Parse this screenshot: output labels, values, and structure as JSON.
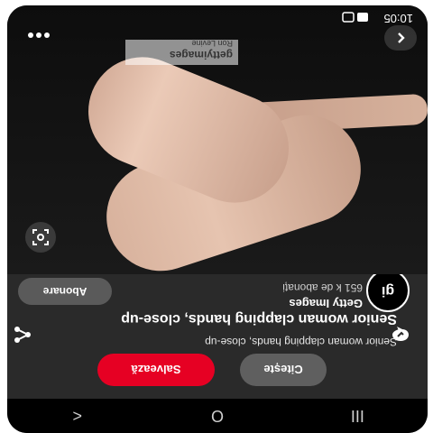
{
  "status_bar": {
    "time": "10:05"
  },
  "navigation": {
    "back_label": "<",
    "home_label": "O",
    "recents_label": "III"
  },
  "pin": {
    "creator_name": "Getty Images",
    "creator_subscribers": "651 k de abonați",
    "subscribe_label": "Abonare",
    "title": "Senior woman clapping hands, close-up",
    "description": "Senior woman clapping hands, close-up",
    "read_label": "Citește",
    "save_label": "Salvează",
    "watermark_text": "gettyimages",
    "photo_credit": "Ron Levine"
  },
  "colors": {
    "save_bg": "#e60023",
    "read_bg": "#5f5f5f",
    "sheet_bg": "#2a2a2a"
  }
}
